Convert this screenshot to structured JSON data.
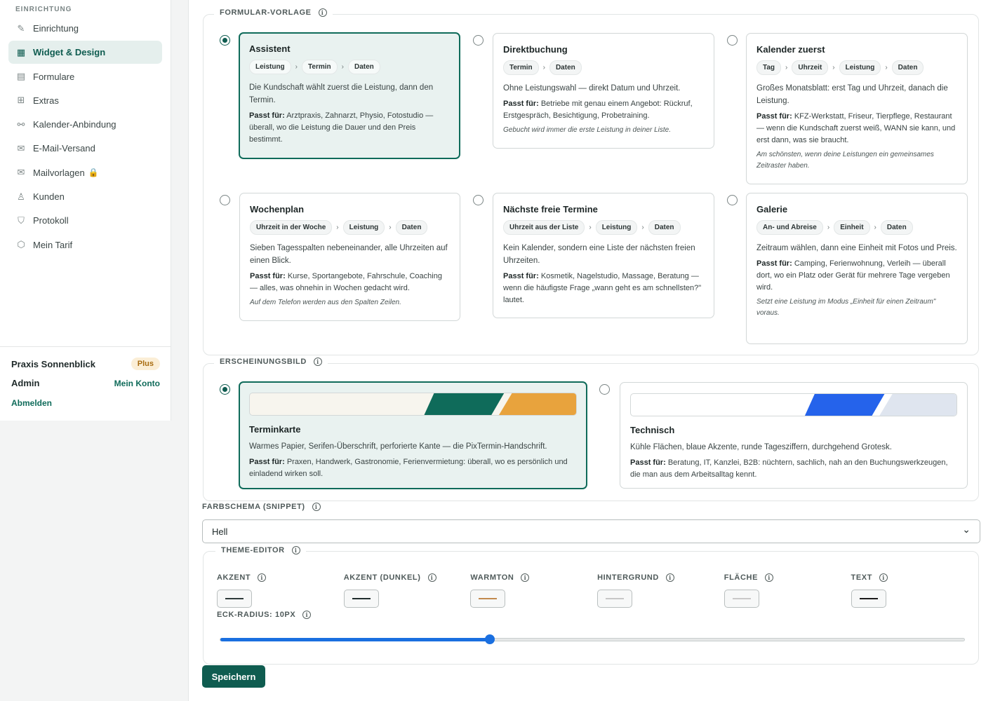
{
  "sidebar": {
    "section_label": "EINRICHTUNG",
    "items": [
      {
        "label": "Einrichtung",
        "icon": "pencil-icon"
      },
      {
        "label": "Widget & Design",
        "icon": "layout-icon",
        "active": true
      },
      {
        "label": "Formulare",
        "icon": "form-icon"
      },
      {
        "label": "Extras",
        "icon": "plus-square-icon"
      },
      {
        "label": "Kalender-Anbindung",
        "icon": "link-icon"
      },
      {
        "label": "E-Mail-Versand",
        "icon": "mail-icon"
      },
      {
        "label": "Mailvorlagen",
        "icon": "mail-template-icon",
        "lock": "🔒"
      },
      {
        "label": "Kunden",
        "icon": "user-icon"
      },
      {
        "label": "Protokoll",
        "icon": "shield-icon"
      },
      {
        "label": "Mein Tarif",
        "icon": "box-icon"
      }
    ],
    "footer": {
      "org_name": "Praxis Sonnenblick",
      "plan_badge": "Plus",
      "role": "Admin",
      "account_link": "Mein Konto",
      "logout": "Abmelden"
    }
  },
  "template_section": {
    "legend": "FORMULAR-VORLAGE",
    "cards": [
      {
        "title": "Assistent",
        "steps": [
          "Leistung",
          "Termin",
          "Daten"
        ],
        "desc": "Die Kundschaft wählt zuerst die Leistung, dann den Termin.",
        "fit_label": "Passt für:",
        "fit": "Arztpraxis, Zahnarzt, Physio, Fotostudio — überall, wo die Leistung die Dauer und den Preis bestimmt.",
        "note": "",
        "selected": true
      },
      {
        "title": "Direktbuchung",
        "steps": [
          "Termin",
          "Daten"
        ],
        "desc": "Ohne Leistungswahl — direkt Datum und Uhrzeit.",
        "fit_label": "Passt für:",
        "fit": "Betriebe mit genau einem Angebot: Rückruf, Erstgespräch, Besichtigung, Probetraining.",
        "note": "Gebucht wird immer die erste Leistung in deiner Liste.",
        "selected": false
      },
      {
        "title": "Kalender zuerst",
        "steps": [
          "Tag",
          "Uhrzeit",
          "Leistung",
          "Daten"
        ],
        "desc": "Großes Monatsblatt: erst Tag und Uhrzeit, danach die Leistung.",
        "fit_label": "Passt für:",
        "fit": "KFZ-Werkstatt, Friseur, Tierpflege, Restaurant — wenn die Kundschaft zuerst weiß, WANN sie kann, und erst dann, was sie braucht.",
        "note": "Am schönsten, wenn deine Leistungen ein gemeinsames Zeitraster haben.",
        "selected": false
      },
      {
        "title": "Wochenplan",
        "steps": [
          "Uhrzeit in der Woche",
          "Leistung",
          "Daten"
        ],
        "desc": "Sieben Tagesspalten nebeneinander, alle Uhrzeiten auf einen Blick.",
        "fit_label": "Passt für:",
        "fit": "Kurse, Sportangebote, Fahrschule, Coaching — alles, was ohnehin in Wochen gedacht wird.",
        "note": "Auf dem Telefon werden aus den Spalten Zeilen.",
        "selected": false
      },
      {
        "title": "Nächste freie Termine",
        "steps": [
          "Uhrzeit aus der Liste",
          "Leistung",
          "Daten"
        ],
        "desc": "Kein Kalender, sondern eine Liste der nächsten freien Uhrzeiten.",
        "fit_label": "Passt für:",
        "fit": "Kosmetik, Nagelstudio, Massage, Beratung — wenn die häufigste Frage „wann geht es am schnellsten?\" lautet.",
        "note": "",
        "selected": false
      },
      {
        "title": "Galerie",
        "steps": [
          "An- und Abreise",
          "Einheit",
          "Daten"
        ],
        "desc": "Zeitraum wählen, dann eine Einheit mit Fotos und Preis.",
        "fit_label": "Passt für:",
        "fit": "Camping, Ferienwohnung, Verleih — überall dort, wo ein Platz oder Gerät für mehrere Tage vergeben wird.",
        "note": "Setzt eine Leistung im Modus „Einheit für einen Zeitraum\" voraus.",
        "selected": false
      }
    ]
  },
  "appearance_section": {
    "legend": "ERSCHEINUNGSBILD",
    "cards": [
      {
        "title": "Terminkarte",
        "desc": "Warmes Papier, Serifen-Überschrift, perforierte Kante — die PixTermin-Handschrift.",
        "fit_label": "Passt für:",
        "fit": "Praxen, Handwerk, Gastronomie, Ferienvermietung: überall, wo es persönlich und einladend wirken soll.",
        "selected": true,
        "colors": {
          "base": "#f7f5ee",
          "a": "#0f6b5a",
          "b": "#e8a33d"
        }
      },
      {
        "title": "Technisch",
        "desc": "Kühle Flächen, blaue Akzente, runde Tagesziffern, durchgehend Grotesk.",
        "fit_label": "Passt für:",
        "fit": "Beratung, IT, Kanzlei, B2B: nüchtern, sachlich, nah an den Buchungswerkzeugen, die man aus dem Arbeitsalltag kennt.",
        "selected": false,
        "colors": {
          "base": "#ffffff",
          "a": "#2563eb",
          "b": "#dfe5ef"
        }
      }
    ]
  },
  "color_scheme": {
    "label": "FARBSCHEMA (SNIPPET)",
    "value": "Hell"
  },
  "theme_editor": {
    "legend": "THEME-EDITOR",
    "fields": [
      {
        "label": "AKZENT",
        "color": "#2f3b3b"
      },
      {
        "label": "AKZENT (DUNKEL)",
        "color": "#1f2d2d"
      },
      {
        "label": "WARMTON",
        "color": "#c28a4e"
      },
      {
        "label": "HINTERGRUND",
        "color": "#c7c7c7"
      },
      {
        "label": "FLÄCHE",
        "color": "#c9c9c9"
      },
      {
        "label": "TEXT",
        "color": "#1a1a1a"
      }
    ],
    "radius_label": "ECK-RADIUS: 10PX",
    "radius_fraction": 0.362
  },
  "save_label": "Speichern",
  "info_glyph": "i",
  "chevron_glyph": "⌄",
  "arrow_glyph": "›"
}
